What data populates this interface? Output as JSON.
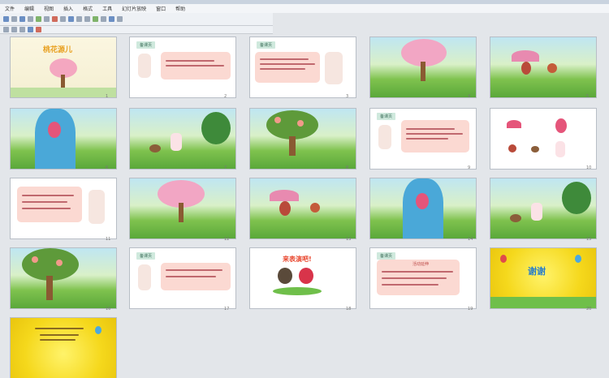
{
  "menu": [
    "文件",
    "编辑",
    "视图",
    "插入",
    "格式",
    "工具",
    "幻灯片放映",
    "窗口",
    "帮助"
  ],
  "slides": [
    {
      "num": "1",
      "kind": "title",
      "title": "桃花源儿"
    },
    {
      "num": "2",
      "kind": "lesson",
      "tag": "备课页"
    },
    {
      "num": "3",
      "kind": "lesson",
      "tag": "备课页"
    },
    {
      "num": "4",
      "kind": "nature"
    },
    {
      "num": "5",
      "kind": "nature"
    },
    {
      "num": "6",
      "kind": "nature"
    },
    {
      "num": "7",
      "kind": "nature"
    },
    {
      "num": "8",
      "kind": "nature"
    },
    {
      "num": "9",
      "kind": "lesson",
      "tag": "备课页"
    },
    {
      "num": "10",
      "kind": "characters"
    },
    {
      "num": "11",
      "kind": "lesson"
    },
    {
      "num": "12",
      "kind": "nature"
    },
    {
      "num": "13",
      "kind": "nature"
    },
    {
      "num": "14",
      "kind": "nature"
    },
    {
      "num": "15",
      "kind": "nature"
    },
    {
      "num": "16",
      "kind": "nature"
    },
    {
      "num": "17",
      "kind": "lesson",
      "tag": "备课页"
    },
    {
      "num": "18",
      "kind": "perform",
      "title": "来表演吧!"
    },
    {
      "num": "19",
      "kind": "lesson",
      "tag": "备课页",
      "sub": "活动延伸"
    },
    {
      "num": "20",
      "kind": "thanks",
      "title": "谢谢"
    },
    {
      "num": "21",
      "kind": "yellow"
    }
  ]
}
